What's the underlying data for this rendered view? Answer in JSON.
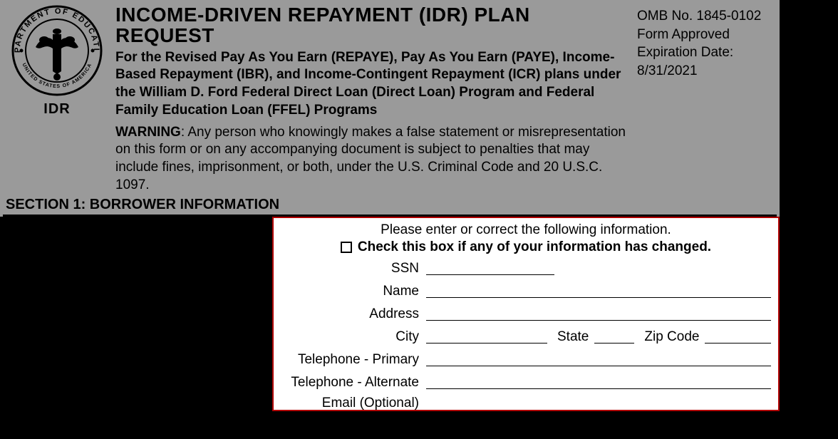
{
  "header": {
    "idr_label": "IDR",
    "title": "INCOME-DRIVEN REPAYMENT (IDR) PLAN REQUEST",
    "subtitle": "For the Revised Pay As You Earn (REPAYE), Pay As You Earn (PAYE), Income-Based Repayment (IBR), and Income-Contingent Repayment (ICR) plans under the William D. Ford Federal Direct Loan (Direct Loan) Program and Federal Family Education Loan (FFEL) Programs",
    "warning_label": "WARNING",
    "warning_text": ": Any person who knowingly makes a false statement or misrepresentation on this form or on any accompanying document is subject to penalties that may include fines, imprisonment, or both, under the U.S. Criminal Code and 20 U.S.C. 1097."
  },
  "omb": {
    "number": "OMB No. 1845-0102",
    "approved": "Form Approved",
    "expiration_label": "Expiration Date:",
    "expiration_date": "8/31/2021"
  },
  "section1": {
    "heading": "SECTION 1: BORROWER INFORMATION"
  },
  "form": {
    "instruction": "Please enter or correct the following information.",
    "checkbox_label": "Check this box if any of your information has changed.",
    "labels": {
      "ssn": "SSN",
      "name": "Name",
      "address": "Address",
      "city": "City",
      "state": "State",
      "zip": "Zip Code",
      "tel_primary": "Telephone - Primary",
      "tel_alternate": "Telephone - Alternate",
      "email": "Email (Optional)"
    }
  }
}
